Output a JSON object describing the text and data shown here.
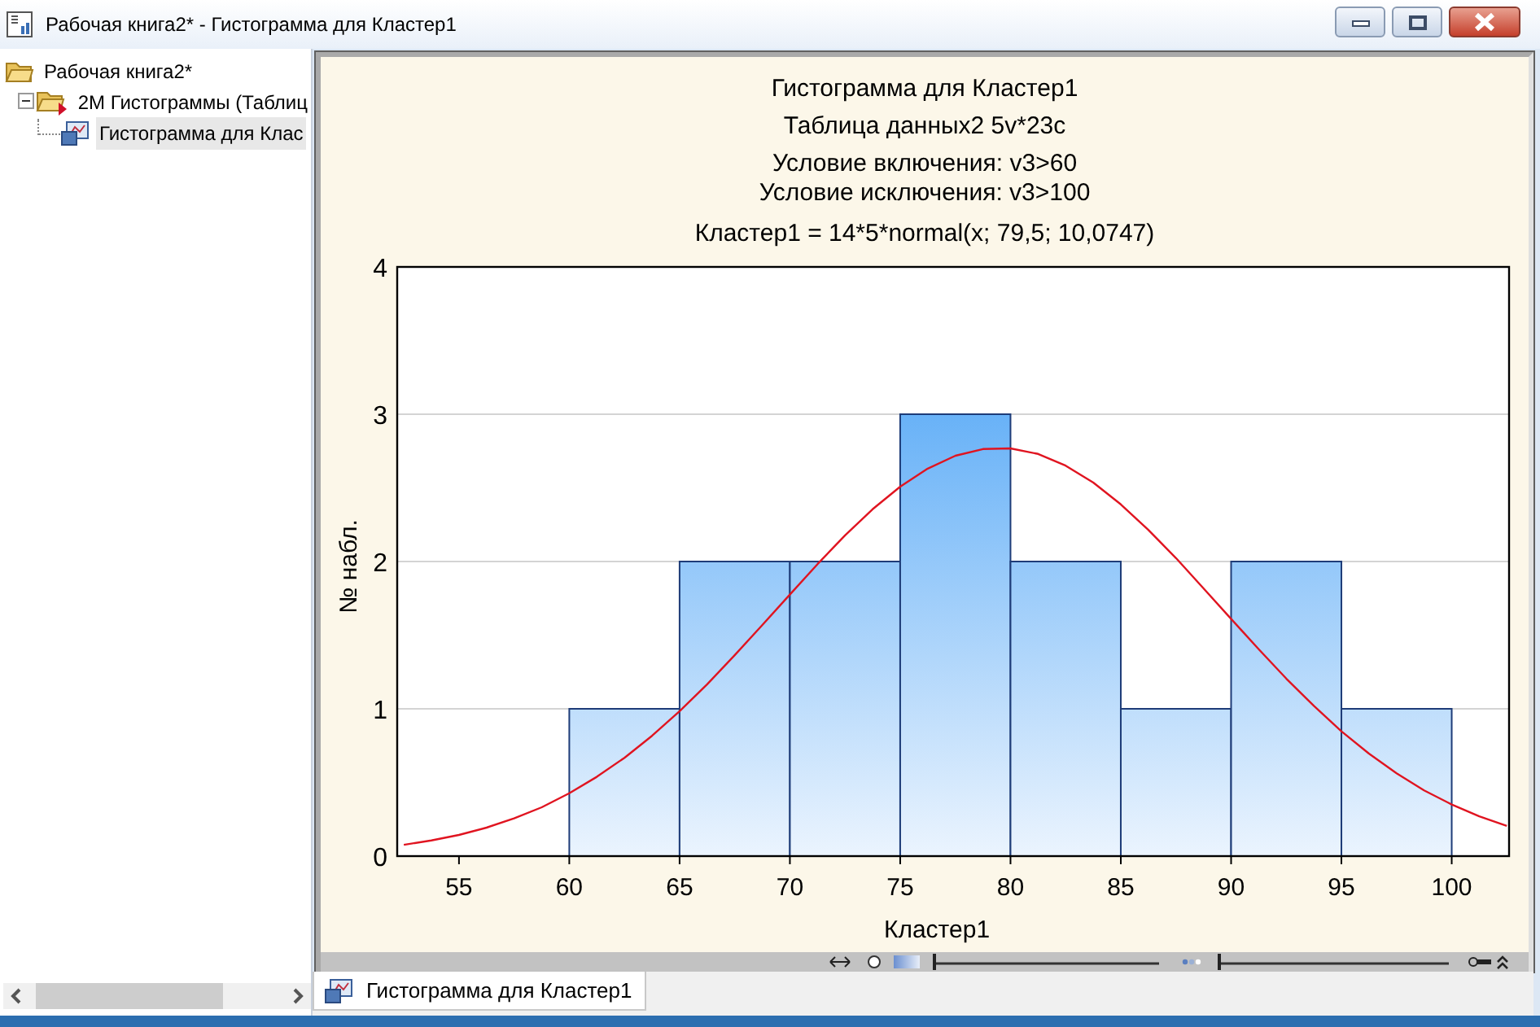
{
  "window": {
    "title": "Рабочая книга2* - Гистограмма для Кластер1"
  },
  "tree": [
    {
      "label": "Рабочая книга2*",
      "kind": "workbook",
      "selected": false,
      "children": [
        {
          "label": "2M Гистограммы (Таблиц",
          "kind": "group",
          "expanded": true,
          "selected": false,
          "children": [
            {
              "label": "Гистограмма для Клас",
              "kind": "graph",
              "selected": true
            }
          ]
        }
      ]
    }
  ],
  "chart": {
    "titles": [
      "Гистограмма для Кластер1",
      "Таблица данных2 5v*23c",
      "Условие включения: v3>60",
      "Условие исключения: v3>100",
      "Кластер1 = 14*5*normal(x; 79,5; 10,0747)"
    ],
    "chart_data": {
      "type": "bar",
      "xlabel": "Кластер1",
      "ylabel": "№ набл.",
      "x": [
        62.5,
        67.5,
        72.5,
        77.5,
        82.5,
        87.5,
        92.5,
        97.5
      ],
      "series": [
        {
          "color": "#1e3c78",
          "values": [
            1,
            2,
            2,
            3,
            2,
            1,
            2,
            1
          ]
        },
        {
          "type": "line",
          "color": "#e01420",
          "x": [
            52.5,
            53.75,
            55,
            56.25,
            57.5,
            58.75,
            60,
            61.25,
            62.5,
            63.75,
            65,
            66.25,
            67.5,
            68.75,
            70,
            71.25,
            72.5,
            73.75,
            75,
            76.25,
            77.5,
            78.75,
            80,
            81.25,
            82.5,
            83.75,
            85,
            86.25,
            87.5,
            88.75,
            90,
            91.25,
            92.5,
            93.75,
            95,
            96.25,
            97.5,
            98.75,
            100,
            101.25,
            102.5
          ],
          "values": [
            0.077,
            0.106,
            0.144,
            0.193,
            0.256,
            0.332,
            0.426,
            0.538,
            0.667,
            0.817,
            0.984,
            1.167,
            1.364,
            1.569,
            1.776,
            1.982,
            2.178,
            2.355,
            2.508,
            2.631,
            2.718,
            2.764,
            2.768,
            2.73,
            2.651,
            2.536,
            2.388,
            2.214,
            2.023,
            1.818,
            1.61,
            1.404,
            1.206,
            1.02,
            0.848,
            0.696,
            0.562,
            0.446,
            0.35,
            0.27,
            0.205
          ]
        }
      ],
      "xlim": [
        52.2,
        102.6
      ],
      "ylim": [
        0,
        4
      ],
      "grid": true,
      "xticks": [
        {
          "value": 55,
          "label": "55"
        },
        {
          "value": 60,
          "label": "60"
        },
        {
          "value": 65,
          "label": "65"
        },
        {
          "value": 70,
          "label": "70"
        },
        {
          "value": 75,
          "label": "75"
        },
        {
          "value": 80,
          "label": "80"
        },
        {
          "value": 85,
          "label": "85"
        },
        {
          "value": 90,
          "label": "90"
        },
        {
          "value": 95,
          "label": "95"
        },
        {
          "value": 100,
          "label": "100"
        }
      ],
      "yticks": [
        {
          "value": 0,
          "label": "0"
        },
        {
          "value": 1,
          "label": "1"
        },
        {
          "value": 2,
          "label": "2"
        },
        {
          "value": 3,
          "label": "3"
        },
        {
          "value": 4,
          "label": "4"
        }
      ]
    }
  },
  "chart_toolbar": {
    "sliders": [
      {
        "level": 0
      },
      {
        "level": 0
      }
    ]
  },
  "tabs": [
    {
      "label": "Гистограмма для Кластер1",
      "selected": true
    }
  ]
}
